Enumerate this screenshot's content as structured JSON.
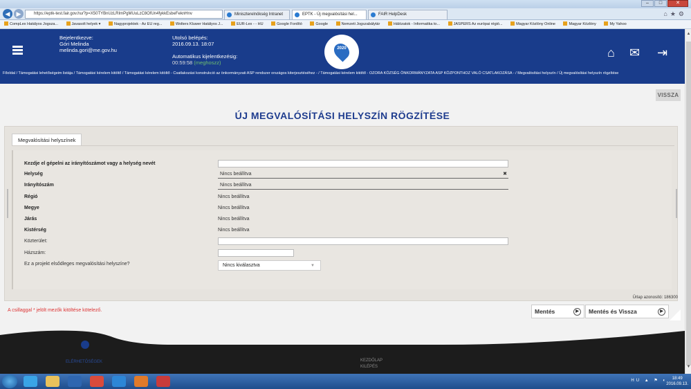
{
  "browser": {
    "address": "https://eptk-test.fair.gov.hu/?p=X50TYBnUzLRImPgMUuLzC8OfUn4fykkEsbeFeknHnv",
    "address_host": "fair.gov.hu",
    "tabs": [
      {
        "label": "Miniszterelnökség Intranet"
      },
      {
        "label": "EPTK - Új megvalósítási hel..."
      },
      {
        "label": "FAIR HelpDesk"
      }
    ],
    "favorites": [
      "CompLex Hatályos Jogsza...",
      "Javasolt helyek ▾",
      "Nagyprojektek - Az EU reg...",
      "Wolters Kluwer Hatályos J...",
      "EUR-Lex - - HU",
      "Google Fordító",
      "Google",
      "Nemzeti Jogszabálytár",
      "Hálózatok - Informatika to...",
      "JASPERS Az európai régió...",
      "Magyar Közlöny Online",
      "Magyar Közlöny",
      "My Yahoo"
    ]
  },
  "header": {
    "logged_in_label": "Bejelentkezve:",
    "user_name": "Góri Melinda",
    "user_email": "melinda.gori@me.gov.hu",
    "last_login_label": "Utolsó belépés:",
    "last_login_value": "2016.09.13. 18:07",
    "auto_logout_label": "Automatikus kijelentkezésig:",
    "auto_logout_time": "00:59:58",
    "auto_logout_hint": "(meghoszz)",
    "logo_text": "2020"
  },
  "breadcrumb": "Főoldal  /  Támogatási lehetőségeim listája  /  Támogatási kérelem kitöltő  /  Támogatási kérelem kitöltő - Csatlakozási konstrukció az önkormányzati ASP rendszer országos kiterjesztéséhez -  /  Támogatási kérelem kitöltő - OZORA KÖZSÉG ÖNKORMÁNYZATA ASP KÖZPONTHOZ VALÓ CSATLAKOZÁSA -  /  Megvalósítási helyszín  /  Új megvalósítási helyszín rögzítése",
  "page": {
    "back_button": "VISSZA",
    "title": "ÚJ MEGVALÓSÍTÁSI HELYSZÍN RÖGZÍTÉSE",
    "tab_label": "Megvalósítási helyszínek",
    "fields": {
      "search_label": "Kezdje el gépelni az irányítószámot vagy a helység nevét",
      "city_label": "Helység",
      "city_value": "Nincs beállítva",
      "zip_label": "Irányítószám",
      "zip_value": "Nincs beállítva",
      "region_label": "Régió",
      "region_value": "Nincs beállítva",
      "county_label": "Megye",
      "county_value": "Nincs beállítva",
      "district_label": "Járás",
      "district_value": "Nincs beállítva",
      "subregion_label": "Kistérség",
      "subregion_value": "Nincs beállítva",
      "street_label": "Közterület:",
      "house_label": "Házszám:",
      "primary_label": "Ez a projekt elsődleges megvalósítási helyszíne?",
      "primary_value": "Nincs kiválasztva"
    },
    "form_id": "Űrlap azonosító: 186300",
    "required_note": "A csillaggal * jelölt mezők kitöltése kötelező.",
    "save_button": "Mentés",
    "save_back_button": "Mentés és Vissza"
  },
  "footer": {
    "accessibility": "ELÉRHETŐSÉGEK",
    "home": "KEZDŐLAP",
    "logout": "KILÉPÉS"
  },
  "taskbar": {
    "lang": "HU",
    "time": "18:49",
    "date": "2016.09.13."
  },
  "icons": {
    "home": "home-icon",
    "mail": "mail-icon",
    "logout": "logout-icon",
    "menu": "hamburger-icon"
  }
}
